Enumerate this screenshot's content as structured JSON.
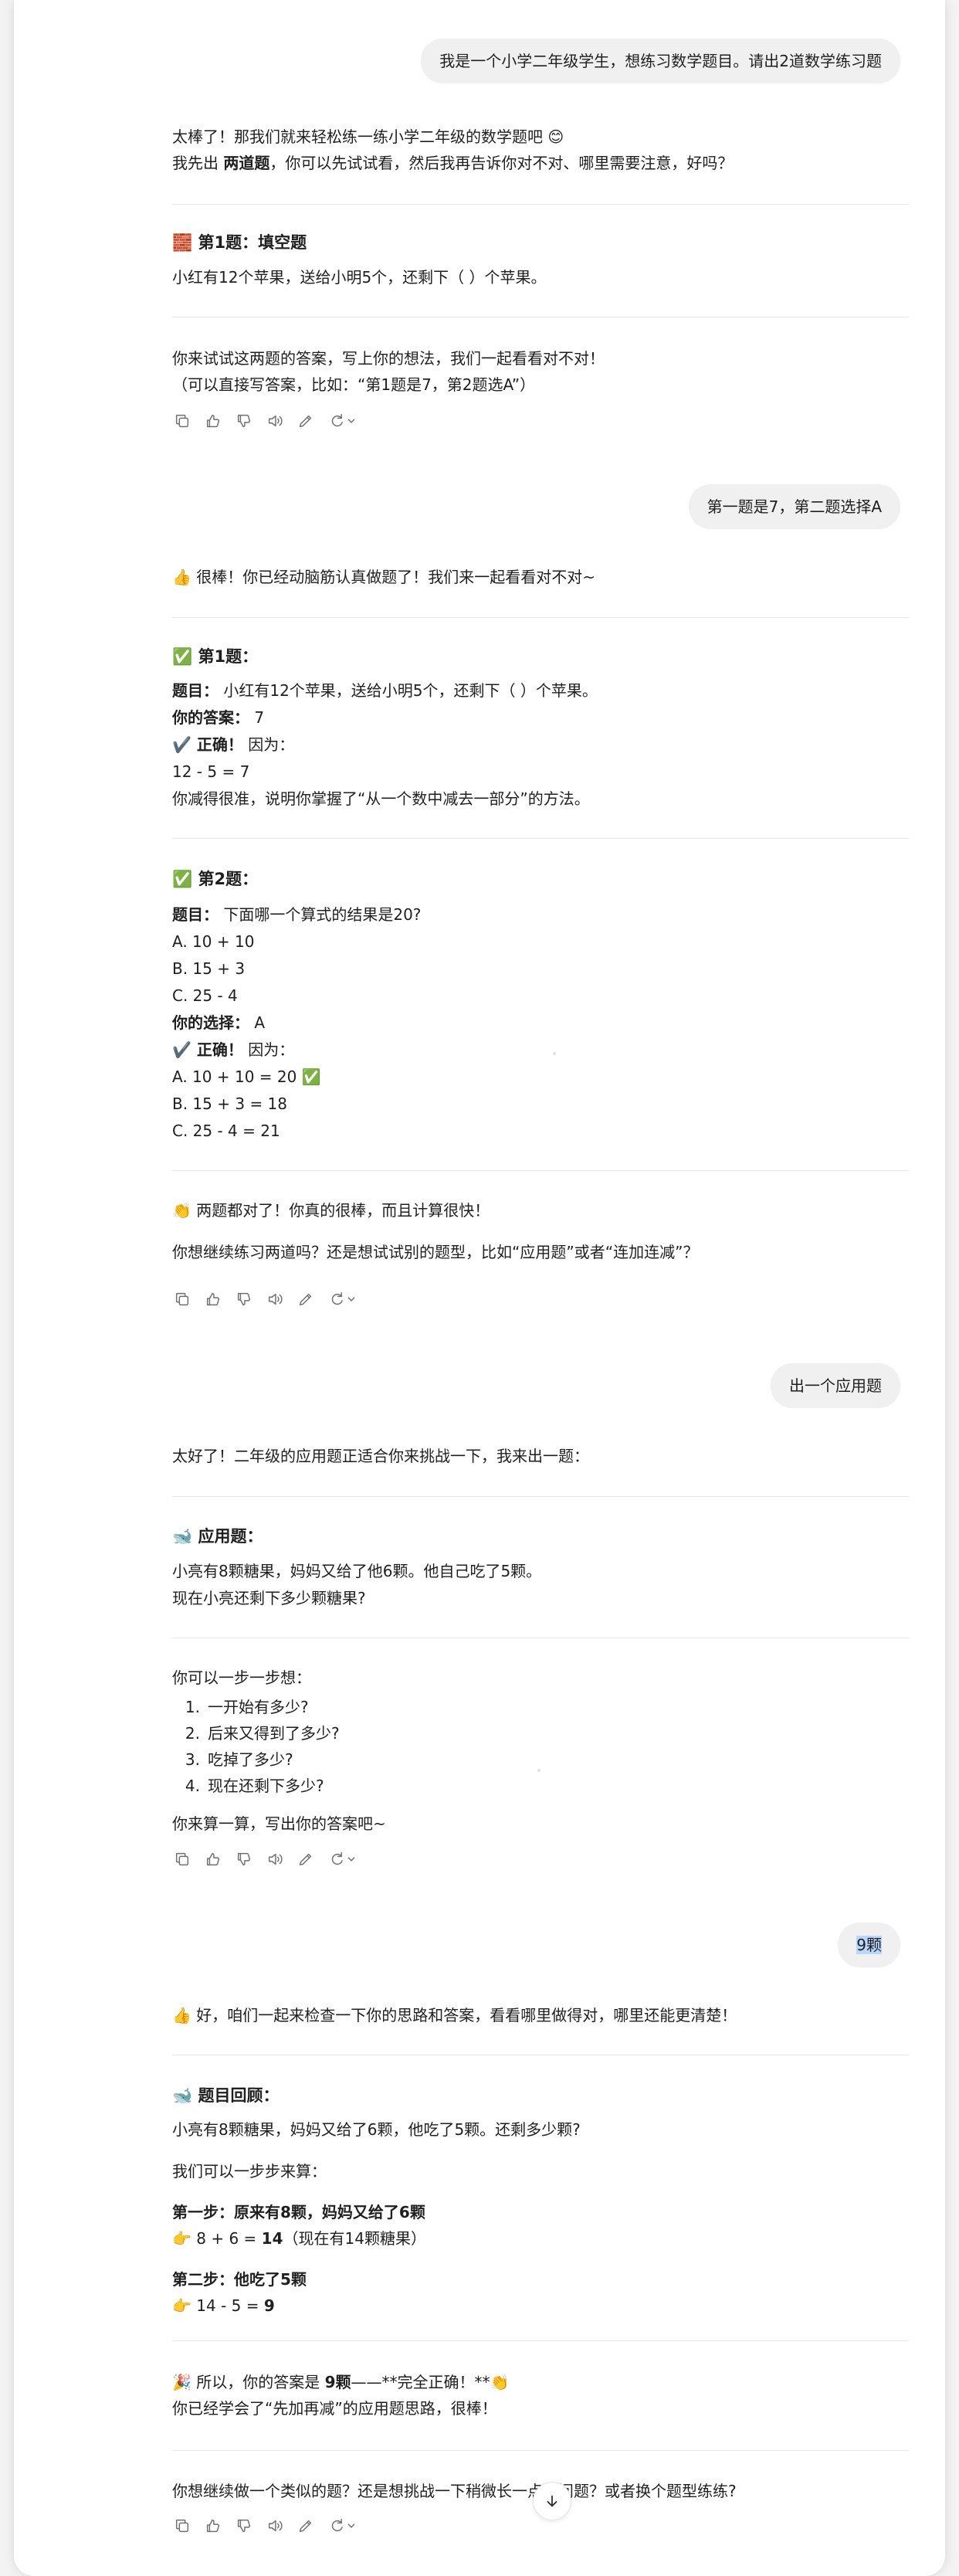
{
  "colors": {
    "page_bg": "#ffffff",
    "outer_bg": "#f3f3f3",
    "user_bubble": "#f0f0f0",
    "selection": "#b9d6fb",
    "divider": "#e6e6e6",
    "action_icon": "#6f6f6f"
  },
  "messages": {
    "u1": "我是一个小学二年级学生，想练习数学题目。请出2道数学练习题",
    "a1": {
      "line1": "太棒了！那我们就来轻松练一练小学二年级的数学题吧 😊",
      "line2_pre": "我先出 ",
      "line2_bold": "两道题",
      "line2_post": "，你可以先试试看，然后我再告诉你对不对、哪里需要注意，好吗？",
      "q1_icon": "🧱",
      "q1_title": "第1题：填空题",
      "q1_body": "小红有12个苹果，送给小明5个，还剩下（ ）个苹果。",
      "invite1": "你来试试这两题的答案，写上你的想法，我们一起看看对不对！",
      "invite2": "（可以直接写答案，比如：“第1题是7，第2题选A”）"
    },
    "u2": "第一题是7，第二题选择A",
    "a2": {
      "intro": "👍 很棒！你已经动脑筋认真做题了！我们来一起看看对不对~",
      "s1_title": "✅ 第1题：",
      "s1_q_label": "题目：",
      "s1_q": " 小红有12个苹果，送给小明5个，还剩下（ ）个苹果。",
      "s1_a_label": "你的答案：",
      "s1_a": " 7",
      "s1_ok_label": "✔️ 正确！",
      "s1_ok": " 因为：",
      "s1_calc": "12 - 5 = 7",
      "s1_note": "你减得很准，说明你掌握了“从一个数中减去一部分”的方法。",
      "s2_title": "✅ 第2题：",
      "s2_q_label": "题目：",
      "s2_q": " 下面哪一个算式的结果是20?",
      "s2_opt_a": "A. 10 + 10",
      "s2_opt_b": "B. 15 + 3",
      "s2_opt_c": "C. 25 - 4",
      "s2_choice_label": "你的选择：",
      "s2_choice": " A",
      "s2_ok_label": "✔️ 正确！",
      "s2_ok": " 因为：",
      "s2_r_a": "A. 10 + 10 = 20 ✅",
      "s2_r_b": "B. 15 + 3 = 18",
      "s2_r_c": "C. 25 - 4 = 21",
      "end1": "👏 两题都对了！你真的很棒，而且计算很快！",
      "end2": "你想继续练习两道吗？还是想试试别的题型，比如“应用题”或者“连加连减”？"
    },
    "u3": "出一个应用题",
    "a3": {
      "intro": "太好了！二年级的应用题正适合你来挑战一下，我来出一题：",
      "title": "🐋 应用题：",
      "body1": "小亮有8颗糖果，妈妈又给了他6颗。他自己吃了5颗。",
      "body2": "现在小亮还剩下多少颗糖果?",
      "step_intro": "你可以一步一步想：",
      "steps": [
        "一开始有多少?",
        "后来又得到了多少?",
        "吃掉了多少?",
        "现在还剩下多少?"
      ],
      "outro": "你来算一算，写出你的答案吧~"
    },
    "u4": "9颗",
    "a4": {
      "intro": "👍 好，咱们一起来检查一下你的思路和答案，看看哪里做得对，哪里还能更清楚！",
      "review_title": "🐋 题目回顾：",
      "review_body": "小亮有8颗糖果，妈妈又给了6颗，他吃了5颗。还剩多少颗?",
      "step_intro": "我们可以一步步来算：",
      "step1_title": "第一步：原来有8颗，妈妈又给了6颗",
      "step1_calc_pre": "👉 8 + 6 = ",
      "step1_calc_bold": "14",
      "step1_calc_post": "（现在有14颗糖果）",
      "step2_title": "第二步：他吃了5颗",
      "step2_calc_pre": "👉 14 - 5 = ",
      "step2_calc_bold": "9",
      "concl1_pre": "🎉 所以，你的答案是 ",
      "concl1_bold": "9颗",
      "concl1_post": "——**完全正确！**👏",
      "concl2": "你已经学会了“先加再减”的应用题思路，很棒！",
      "final": "你想继续做一个类似的题？还是想挑战一下稍微长一点的问题？或者换个题型练练?"
    }
  },
  "action_icons": [
    "copy-icon",
    "thumbs-up-icon",
    "thumbs-down-icon",
    "speaker-icon",
    "edit-icon",
    "regenerate-icon"
  ]
}
